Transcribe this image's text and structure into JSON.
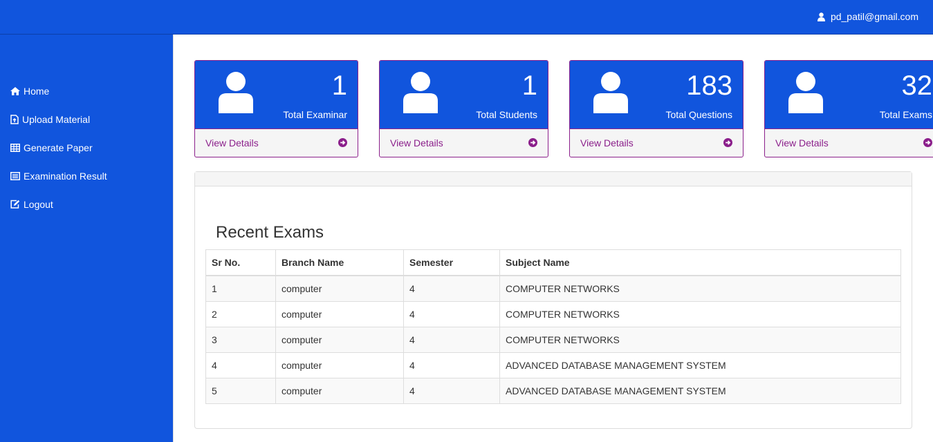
{
  "topbar": {
    "user_email": "pd_patil@gmail.com"
  },
  "sidebar": {
    "items": [
      {
        "label": "Home",
        "icon": "home-icon"
      },
      {
        "label": "Upload Material",
        "icon": "file-upload-icon"
      },
      {
        "label": "Generate Paper",
        "icon": "table-icon"
      },
      {
        "label": "Examination Result",
        "icon": "list-icon"
      },
      {
        "label": "Logout",
        "icon": "edit-icon"
      }
    ]
  },
  "cards": [
    {
      "value": "1",
      "label": "Total Examinar",
      "link": "View Details"
    },
    {
      "value": "1",
      "label": "Total Students",
      "link": "View Details"
    },
    {
      "value": "183",
      "label": "Total Questions",
      "link": "View Details"
    },
    {
      "value": "32",
      "label": "Total Exams",
      "link": "View Details"
    }
  ],
  "recent_exams": {
    "title": "Recent Exams",
    "columns": [
      "Sr No.",
      "Branch Name",
      "Semester",
      "Subject Name"
    ],
    "rows": [
      [
        "1",
        "computer",
        "4",
        "COMPUTER NETWORKS"
      ],
      [
        "2",
        "computer",
        "4",
        "COMPUTER NETWORKS"
      ],
      [
        "3",
        "computer",
        "4",
        "COMPUTER NETWORKS"
      ],
      [
        "4",
        "computer",
        "4",
        "ADVANCED DATABASE MANAGEMENT SYSTEM"
      ],
      [
        "5",
        "computer",
        "4",
        "ADVANCED DATABASE MANAGEMENT SYSTEM"
      ]
    ]
  },
  "colors": {
    "primary": "#1155dd",
    "accent": "#8b1f8b"
  }
}
